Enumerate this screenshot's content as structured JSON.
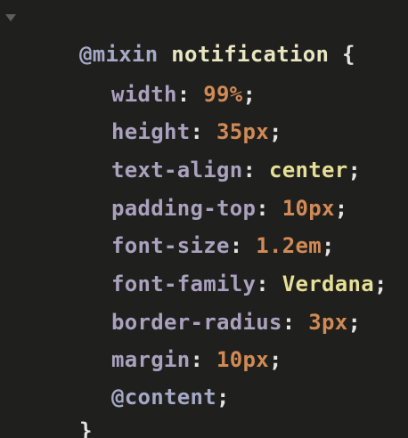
{
  "code": {
    "mixin_keyword": "@mixin",
    "mixin_name": "notification",
    "open_brace": "{",
    "close_brace": "}",
    "declarations": [
      {
        "property": "width",
        "value": "99%",
        "value_type": "number"
      },
      {
        "property": "height",
        "value": "35px",
        "value_type": "number"
      },
      {
        "property": "text-align",
        "value": "center",
        "value_type": "keyword"
      },
      {
        "property": "padding-top",
        "value": "10px",
        "value_type": "number"
      },
      {
        "property": "font-size",
        "value": "1.2em",
        "value_type": "number"
      },
      {
        "property": "font-family",
        "value": "Verdana",
        "value_type": "keyword"
      },
      {
        "property": "border-radius",
        "value": "3px",
        "value_type": "number"
      },
      {
        "property": "margin",
        "value": "10px",
        "value_type": "number"
      }
    ],
    "content_directive": "@content",
    "colon": ":",
    "semicolon": ";"
  },
  "colors": {
    "background": "#1f1f1d",
    "at_rule": "#a5a9c6",
    "property": "#a9a2bf",
    "number_value": "#d18a55",
    "keyword_value": "#e6df97",
    "punctuation": "#e3e3e3"
  },
  "icons": {
    "fold": "fold-arrow-icon"
  }
}
